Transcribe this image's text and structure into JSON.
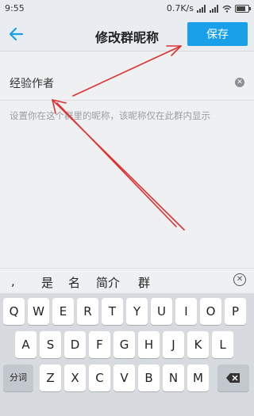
{
  "status": {
    "time": "9:55",
    "speed": "0.7K/s"
  },
  "header": {
    "title": "修改群昵称",
    "save_label": "保存",
    "back_icon": "arrow-left-icon"
  },
  "form": {
    "nickname_value": "经验作者",
    "hint": "设置你在这个群里的昵称，该昵称仅在此群内显示"
  },
  "suggestions": [
    ",",
    "是",
    "名",
    "简介",
    "群"
  ],
  "keyboard": {
    "row1": [
      "Q",
      "W",
      "E",
      "R",
      "T",
      "Y",
      "U",
      "I",
      "O",
      "P"
    ],
    "row2": [
      "A",
      "S",
      "D",
      "F",
      "G",
      "H",
      "J",
      "K",
      "L"
    ],
    "row3": [
      "Z",
      "X",
      "C",
      "V",
      "B",
      "N",
      "M"
    ],
    "left_fn": "分词",
    "delete_icon": "backspace-icon"
  },
  "colors": {
    "accent": "#1aa0e8",
    "annotation_arrows": "#e03030"
  }
}
